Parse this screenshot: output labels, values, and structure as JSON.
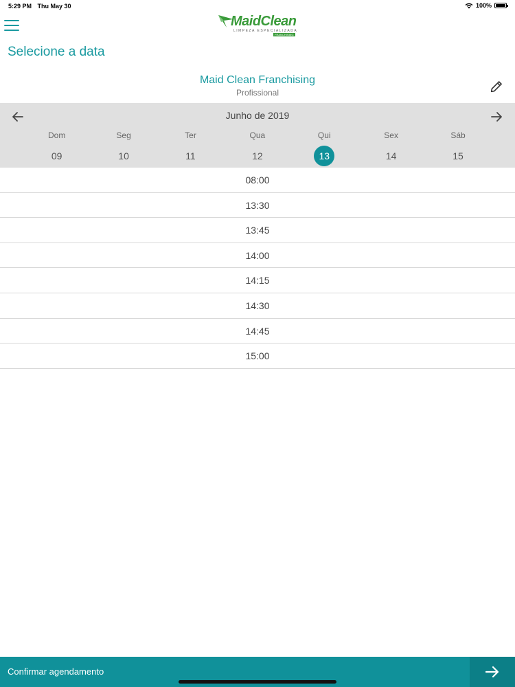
{
  "status": {
    "time": "5:29 PM",
    "date": "Thu May 30",
    "battery": "100%",
    "battery_level": 1.0
  },
  "app": {
    "brand": "MaidClean",
    "tagline": "LIMPEZA ESPECIALIZADA",
    "franchising_tag": "FRANCHISING"
  },
  "page": {
    "title": "Selecione a data"
  },
  "professional": {
    "name": "Maid Clean Franchising",
    "role": "Profissional"
  },
  "calendar": {
    "month": "Junho de 2019",
    "days": [
      {
        "name": "Dom",
        "date": "09"
      },
      {
        "name": "Seg",
        "date": "10"
      },
      {
        "name": "Ter",
        "date": "11"
      },
      {
        "name": "Qua",
        "date": "12"
      },
      {
        "name": "Qui",
        "date": "13",
        "selected": true
      },
      {
        "name": "Sex",
        "date": "14"
      },
      {
        "name": "Sáb",
        "date": "15"
      }
    ]
  },
  "slots": [
    "08:00",
    "13:30",
    "13:45",
    "14:00",
    "14:15",
    "14:30",
    "14:45",
    "15:00"
  ],
  "footer": {
    "confirm_label": "Confirmar agendamento"
  },
  "colors": {
    "accent": "#1a9aa0",
    "footer": "#10919a",
    "brand_green": "#3a9b3a"
  },
  "icons": [
    "menu-icon",
    "edit-icon",
    "arrow-left-icon",
    "arrow-right-icon",
    "wifi-icon",
    "battery-icon"
  ]
}
